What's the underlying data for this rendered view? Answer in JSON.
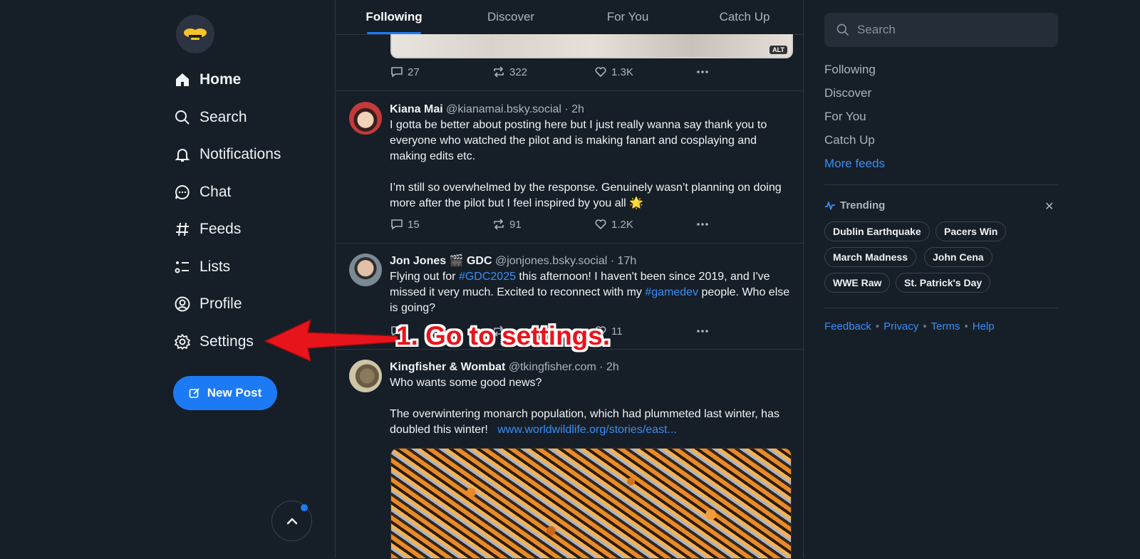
{
  "nav": {
    "items": [
      {
        "label": "Home",
        "icon": "home-icon"
      },
      {
        "label": "Search",
        "icon": "search-icon"
      },
      {
        "label": "Notifications",
        "icon": "bell-icon"
      },
      {
        "label": "Chat",
        "icon": "chat-icon"
      },
      {
        "label": "Feeds",
        "icon": "hash-icon"
      },
      {
        "label": "Lists",
        "icon": "list-icon"
      },
      {
        "label": "Profile",
        "icon": "profile-icon"
      },
      {
        "label": "Settings",
        "icon": "gear-icon"
      }
    ],
    "new_post_label": "New Post"
  },
  "tabs": [
    "Following",
    "Discover",
    "For You",
    "Catch Up"
  ],
  "posts": [
    {
      "actions": {
        "replies": "27",
        "reposts": "322",
        "likes": "1.3K"
      },
      "image_alt_badge": "ALT"
    },
    {
      "name": "Kiana Mai",
      "handle": "@kianamai.bsky.social",
      "time": "· 2h",
      "text1": "I gotta be better about posting here but I just really wanna say thank you to everyone who watched the pilot and is making fanart and cosplaying and making edits etc.",
      "text2": "I’m still so overwhelmed by the response. Genuinely wasn’t planning on doing more after the pilot but I feel inspired by you all 🌟",
      "actions": {
        "replies": "15",
        "reposts": "91",
        "likes": "1.2K"
      }
    },
    {
      "name": "Jon Jones 🎬 GDC",
      "handle": "@jonjones.bsky.social",
      "time": "· 17h",
      "text_a": "Flying out for ",
      "tag1": "#GDC2025",
      "text_b": " this afternoon! I haven't been since 2019, and I've missed it very much. Excited to reconnect with my ",
      "tag2": "#gamedev",
      "text_c": " people. Who else is going?",
      "actions": {
        "likes": "11"
      }
    },
    {
      "name": "Kingfisher & Wombat",
      "handle": "@tkingfisher.com",
      "time": "· 2h",
      "text1": "Who wants some good news?",
      "text2": "The overwintering monarch population, which had plummeted last winter, has doubled this winter!",
      "link": "www.worldwildlife.org/stories/east..."
    }
  ],
  "right": {
    "search_placeholder": "Search",
    "feeds": [
      "Following",
      "Discover",
      "For You",
      "Catch Up"
    ],
    "more_feeds": "More feeds",
    "trending_title": "Trending",
    "trending": [
      "Dublin Earthquake",
      "Pacers Win",
      "March Madness",
      "John Cena",
      "WWE Raw",
      "St. Patrick's Day"
    ],
    "footer": [
      "Feedback",
      "Privacy",
      "Terms",
      "Help"
    ]
  },
  "annotation": {
    "text": "1. Go to settings.",
    "color": "#e8141c"
  },
  "colors": {
    "background": "#161e27",
    "accent": "#1d7af5",
    "link": "#3a8ef6"
  }
}
